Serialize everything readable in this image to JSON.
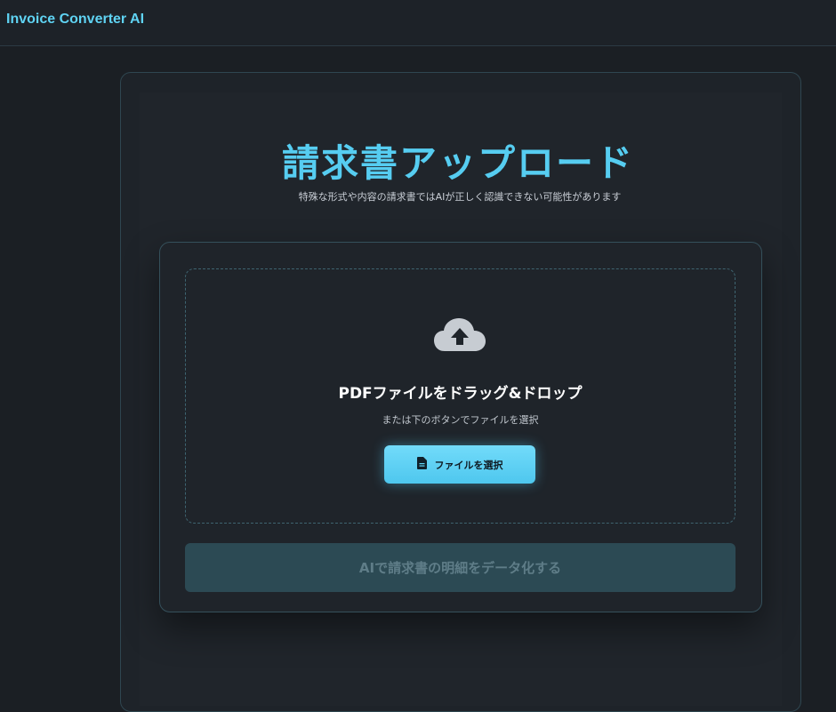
{
  "app": {
    "title": "Invoice Converter AI"
  },
  "page": {
    "title": "請求書アップロード",
    "subtitle": "特殊な形式や内容の請求書ではAIが正しく認識できない可能性があります"
  },
  "dropzone": {
    "icon": "cloud-upload-icon",
    "title": "PDFファイルをドラッグ&ドロップ",
    "subtitle": "または下のボタンでファイルを選択",
    "select_button": {
      "icon": "file-icon",
      "label": "ファイルを選択"
    }
  },
  "actions": {
    "convert_label": "AIで請求書の明細をデータ化する",
    "convert_disabled": true
  },
  "colors": {
    "accent": "#56cdf1",
    "background": "#1b1f24",
    "disabled_button": "#2c4a54"
  }
}
